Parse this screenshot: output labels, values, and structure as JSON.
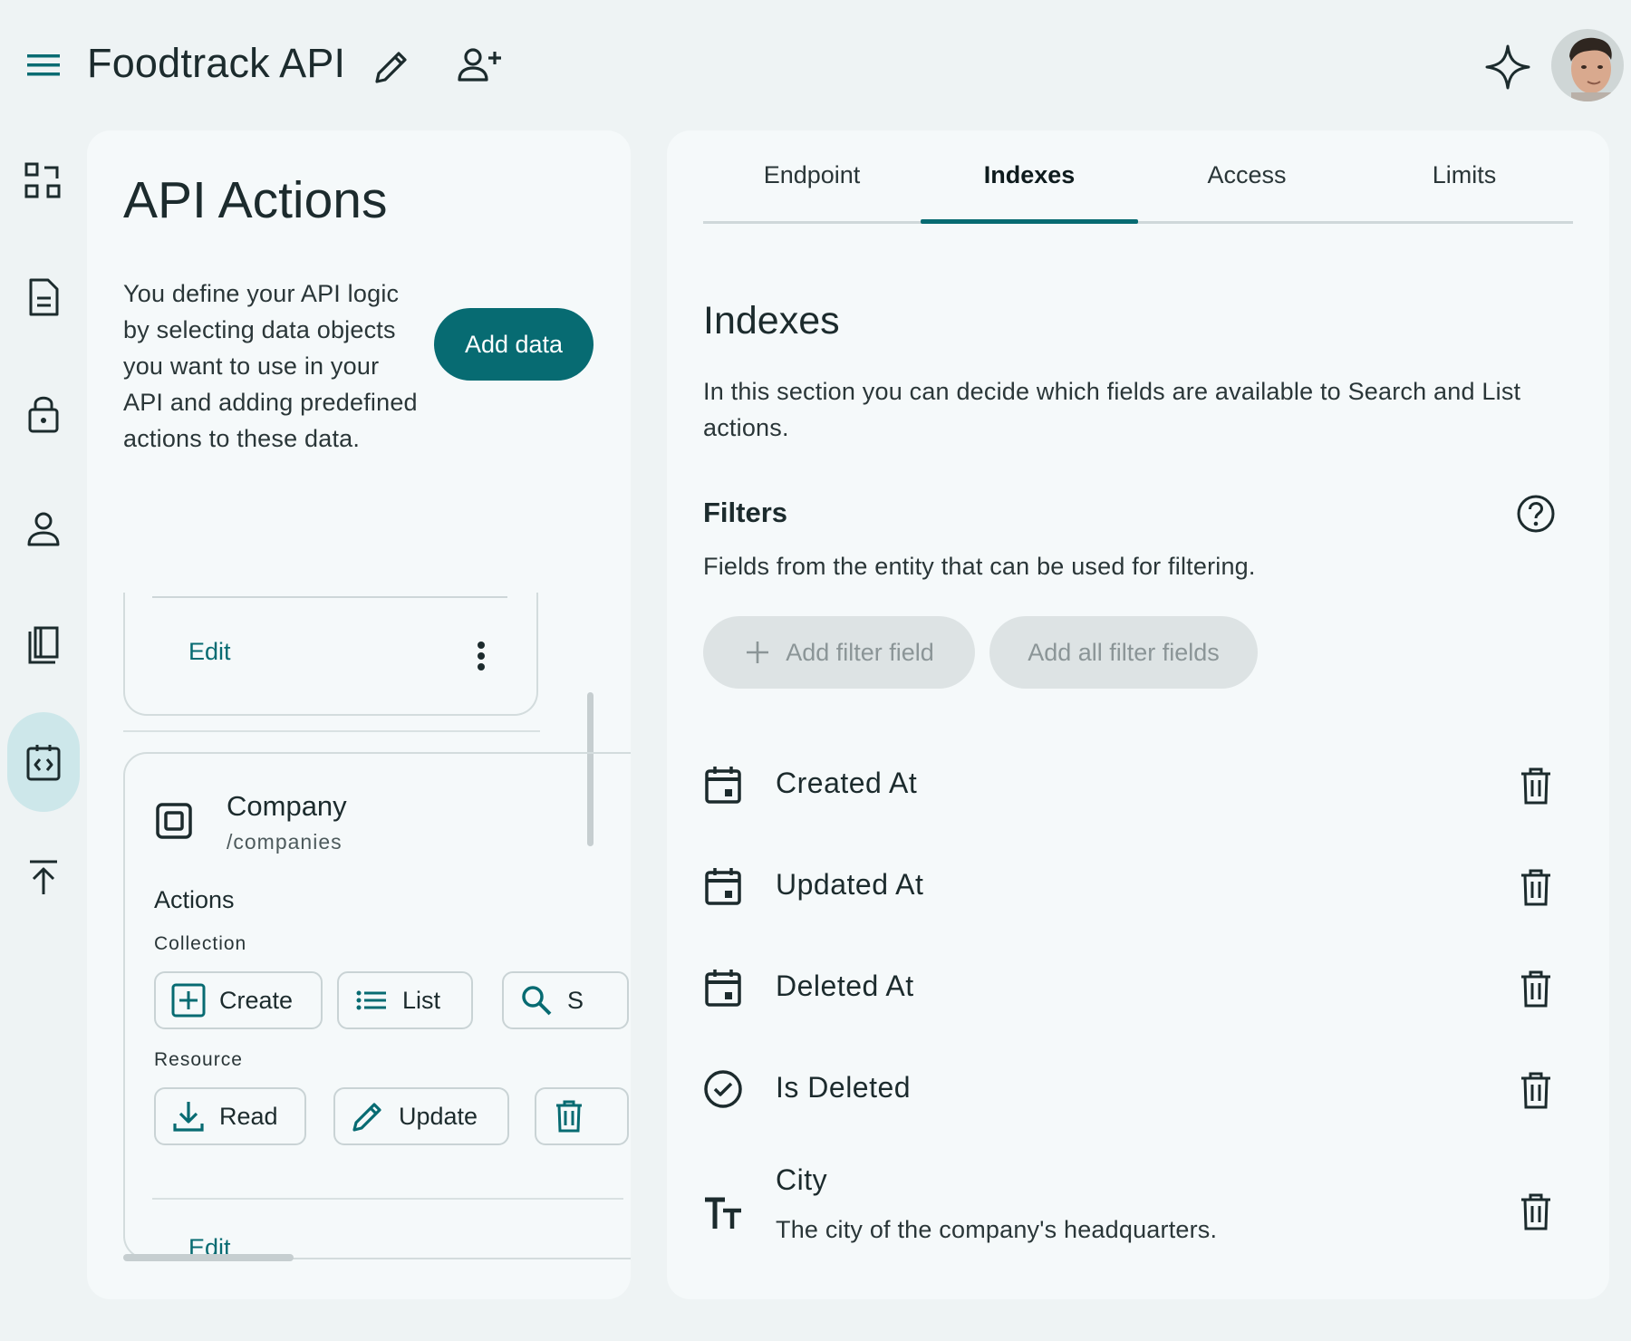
{
  "app": {
    "title": "Foodtrack API"
  },
  "colors": {
    "accent": "#076b72",
    "background": "#eef3f4",
    "panel": "#f5f9fa",
    "rail_active": "#cde7ea",
    "disabled_button": "#dde3e4"
  },
  "topbar": {
    "menu_icon": "menu-icon",
    "edit_icon": "pencil-icon",
    "share_icon": "person-add-icon",
    "assistant_icon": "sparkle-icon"
  },
  "rail": {
    "items": [
      {
        "icon": "dashboard-icon"
      },
      {
        "icon": "document-icon"
      },
      {
        "icon": "lock-icon"
      },
      {
        "icon": "person-icon"
      },
      {
        "icon": "book-icon"
      },
      {
        "icon": "api-code-icon",
        "active": true
      },
      {
        "icon": "publish-icon"
      }
    ]
  },
  "left_panel": {
    "title": "API Actions",
    "description": "You define your API logic by selecting data objects you want to use in your API and adding predefined actions to these data.",
    "add_button": "Add data",
    "card1": {
      "edit_label": "Edit"
    },
    "card2": {
      "entity_name": "Company",
      "entity_path": "/companies",
      "actions_heading": "Actions",
      "collection_label": "Collection",
      "collection_actions": [
        {
          "label": "Create",
          "icon": "add-box-icon"
        },
        {
          "label": "List",
          "icon": "list-icon"
        },
        {
          "label": "S",
          "icon": "search-icon"
        }
      ],
      "resource_label": "Resource",
      "resource_actions": [
        {
          "label": "Read",
          "icon": "download-icon"
        },
        {
          "label": "Update",
          "icon": "pencil-icon"
        },
        {
          "label": "",
          "icon": "trash-icon"
        }
      ],
      "edit_label": "Edit"
    }
  },
  "right_panel": {
    "tabs": [
      {
        "label": "Endpoint"
      },
      {
        "label": "Indexes",
        "active": true
      },
      {
        "label": "Access"
      },
      {
        "label": "Limits"
      }
    ],
    "section_title": "Indexes",
    "section_description": "In this section you can decide which fields are available to Search and List actions.",
    "filters": {
      "heading": "Filters",
      "description": "Fields from the entity that can be used for filtering.",
      "add_filter_label": "Add filter field",
      "add_all_label": "Add all filter fields",
      "fields": [
        {
          "name": "Created At",
          "icon": "calendar-icon"
        },
        {
          "name": "Updated At",
          "icon": "calendar-icon"
        },
        {
          "name": "Deleted At",
          "icon": "calendar-icon"
        },
        {
          "name": "Is Deleted",
          "icon": "check-circle-icon"
        },
        {
          "name": "City",
          "description": "The city of the company's headquarters.",
          "icon": "text-fields-icon"
        }
      ]
    }
  }
}
